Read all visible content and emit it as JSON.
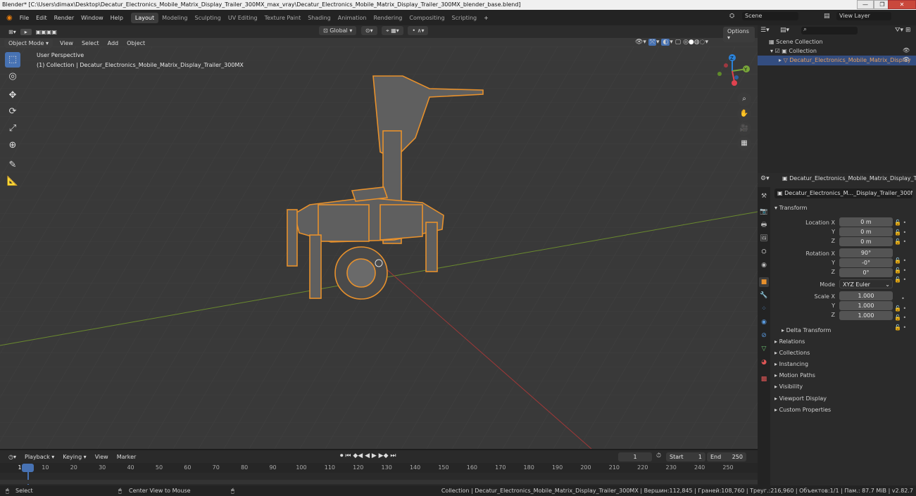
{
  "window": {
    "title": "Blender* [C:\\Users\\dimax\\Desktop\\Decatur_Electronics_Mobile_Matrix_Display_Trailer_300MX_max_vray\\Decatur_Electronics_Mobile_Matrix_Display_Trailer_300MX_blender_base.blend]",
    "minimize": "—",
    "maximize": "❐",
    "close": "✕"
  },
  "topbar": {
    "menus": [
      "File",
      "Edit",
      "Render",
      "Window",
      "Help"
    ],
    "workspaces": [
      "Layout",
      "Modeling",
      "Sculpting",
      "UV Editing",
      "Texture Paint",
      "Shading",
      "Animation",
      "Rendering",
      "Compositing",
      "Scripting"
    ],
    "active_workspace": "Layout",
    "add_workspace": "+",
    "scene_label": "Scene",
    "view_layer_label": "View Layer"
  },
  "viewport": {
    "mode": "Object Mode",
    "menus": [
      "View",
      "Select",
      "Add",
      "Object"
    ],
    "transform_orientation": "Global",
    "options": "Options",
    "overlay_title": "User Perspective",
    "overlay_subtitle": "(1) Collection | Decatur_Electronics_Mobile_Matrix_Display_Trailer_300MX",
    "axis_x": "X",
    "axis_y": "Y",
    "axis_z": "Z"
  },
  "outliner": {
    "search_placeholder": "",
    "root": "Scene Collection",
    "collection": "Collection",
    "object": "Decatur_Electronics_Mobile_Matrix_Display"
  },
  "properties": {
    "header_object": "Decatur_Electronics_Mobile_Matrix_Display_Trailer",
    "object_name": "Decatur_Electronics_M..._Display_Trailer_300MX",
    "transform_title": "Transform",
    "location_label": "Location X",
    "location": [
      "0 m",
      "0 m",
      "0 m"
    ],
    "rotation_label": "Rotation X",
    "rotation": [
      "90°",
      "-0°",
      "0°"
    ],
    "mode_label": "Mode",
    "mode_value": "XYZ Euler",
    "scale_label": "Scale X",
    "scale": [
      "1.000",
      "1.000",
      "1.000"
    ],
    "axis_y": "Y",
    "axis_z": "Z",
    "delta_transform": "Delta Transform",
    "sections": [
      "Relations",
      "Collections",
      "Instancing",
      "Motion Paths",
      "Visibility",
      "Viewport Display",
      "Custom Properties"
    ]
  },
  "timeline": {
    "menus": [
      "Playback",
      "Keying",
      "View",
      "Marker"
    ],
    "current_frame": "1",
    "start_label": "Start",
    "start": "1",
    "end_label": "End",
    "end": "250",
    "ruler": [
      "1",
      "10",
      "20",
      "30",
      "40",
      "50",
      "60",
      "70",
      "80",
      "90",
      "100",
      "110",
      "120",
      "130",
      "140",
      "150",
      "160",
      "170",
      "180",
      "190",
      "200",
      "210",
      "220",
      "230",
      "240",
      "250"
    ]
  },
  "statusbar": {
    "select": "Select",
    "center_view": "Center View to Mouse",
    "stats": "Collection | Decatur_Electronics_Mobile_Matrix_Display_Trailer_300MX | Вершин:112,845 | Граней:108,760 | Треуг.:216,960 | Объектов:1/1 | Пам.: 87.7 MiB | v2.82.7"
  },
  "colors": {
    "selection_outline": "#e8912c",
    "active_tool": "#4772b3",
    "axis_x": "#e0424f",
    "axis_y": "#78a53a",
    "axis_z": "#2b82d8"
  }
}
